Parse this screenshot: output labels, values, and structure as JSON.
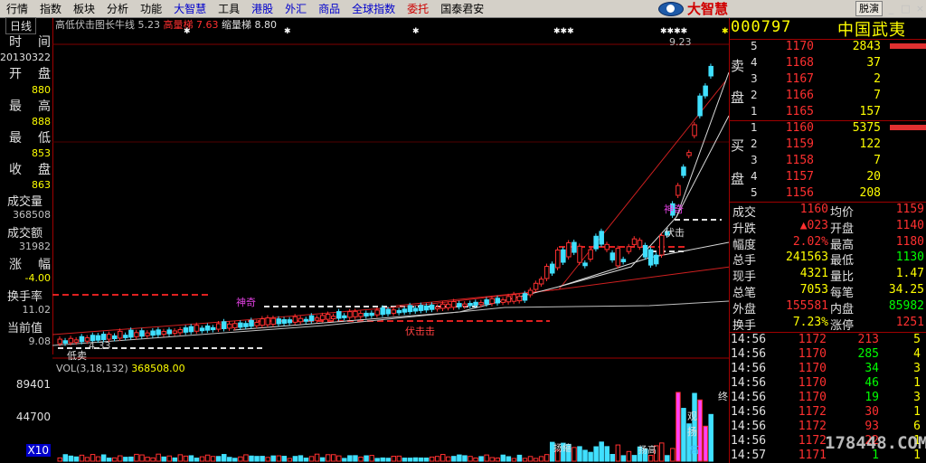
{
  "menu": [
    {
      "label": "行情",
      "color": "normal"
    },
    {
      "label": "指数",
      "color": "normal"
    },
    {
      "label": "板块",
      "color": "normal"
    },
    {
      "label": "分析",
      "color": "normal"
    },
    {
      "label": "功能",
      "color": "normal"
    },
    {
      "label": "大智慧",
      "color": "blue"
    },
    {
      "label": "工具",
      "color": "normal"
    },
    {
      "label": "港股",
      "color": "blue"
    },
    {
      "label": "外汇",
      "color": "blue"
    },
    {
      "label": "商品",
      "color": "blue"
    },
    {
      "label": "全球指数",
      "color": "blue"
    },
    {
      "label": "委托",
      "color": "red"
    },
    {
      "label": "国泰君安",
      "color": "normal"
    }
  ],
  "logo_text": "大智慧",
  "window_buttons": {
    "demo": "脱演",
    "min": "_",
    "restore": "□",
    "close": "×"
  },
  "period": "日线",
  "chart_header": {
    "indicator": "高低伏击图长牛线",
    "v1": "5.23",
    "label2": "高量梯",
    "v2": "7.63",
    "label3": "缩量梯",
    "v3": "8.80"
  },
  "left_panel": {
    "time_label": "时　间",
    "time_value": "20130322",
    "open_label": "开　盘",
    "open_value": "880",
    "high_label": "最　高",
    "high_value": "888",
    "low_label": "最　低",
    "low_value": "853",
    "close_label": "收　盘",
    "close_value": "863",
    "volume_label": "成交量",
    "volume_value": "368508",
    "amount_label": "成交额",
    "amount_value": "31982",
    "change_label": "涨　幅",
    "change_value": "-4.00",
    "turnover_label": "换手率",
    "turnover_value": "11.02",
    "current_label": "当前值",
    "current_value": "9.08"
  },
  "chart_annotations": {
    "shenqi1": "神奇",
    "shenqi2": "神奇",
    "fuji1": "伏击",
    "fuji2": "伏击击",
    "price_low": "4.33",
    "price_high": "9.23",
    "bottom_label": "低卖"
  },
  "volume": {
    "header": "VOL(3,18,132)",
    "header_value": "368508.00",
    "axis": [
      "89401",
      "44700",
      "X10"
    ],
    "tags": [
      "观",
      "扬",
      "高",
      "缩",
      "终",
      "扬缩",
      "扬高"
    ]
  },
  "stock": {
    "code": "000797",
    "name": "中国武夷"
  },
  "order_book": {
    "sell_label": [
      "卖",
      "盘"
    ],
    "buy_label": [
      "买",
      "盘"
    ],
    "asks": [
      {
        "level": "5",
        "price": "1170",
        "qty": "2843"
      },
      {
        "level": "4",
        "price": "1168",
        "qty": "37"
      },
      {
        "level": "3",
        "price": "1167",
        "qty": "2"
      },
      {
        "level": "2",
        "price": "1166",
        "qty": "7"
      },
      {
        "level": "1",
        "price": "1165",
        "qty": "157"
      }
    ],
    "bids": [
      {
        "level": "1",
        "price": "1160",
        "qty": "5375"
      },
      {
        "level": "2",
        "price": "1159",
        "qty": "122"
      },
      {
        "level": "3",
        "price": "1158",
        "qty": "7"
      },
      {
        "level": "4",
        "price": "1157",
        "qty": "20"
      },
      {
        "level": "5",
        "price": "1156",
        "qty": "208"
      }
    ]
  },
  "stats": [
    {
      "l1": "成交",
      "v1": "1160",
      "c1": "#ff3030",
      "l2": "均价",
      "v2": "1159",
      "c2": "#ff3030"
    },
    {
      "l1": "升跌",
      "v1": "▲023",
      "c1": "#ff3030",
      "l2": "开盘",
      "v2": "1140",
      "c2": "#ff3030"
    },
    {
      "l1": "幅度",
      "v1": "2.02%",
      "c1": "#ff3030",
      "l2": "最高",
      "v2": "1180",
      "c2": "#ff3030"
    },
    {
      "l1": "总手",
      "v1": "241563",
      "c1": "#ffff00",
      "l2": "最低",
      "v2": "1130",
      "c2": "#00ff00"
    },
    {
      "l1": "现手",
      "v1": "4321",
      "c1": "#ffff00",
      "l2": "量比",
      "v2": "1.47",
      "c2": "#ffff00"
    },
    {
      "l1": "总笔",
      "v1": "7053",
      "c1": "#ffff00",
      "l2": "每笔",
      "v2": "34.25",
      "c2": "#ffff00"
    },
    {
      "l1": "外盘",
      "v1": "155581",
      "c1": "#ff3030",
      "l2": "内盘",
      "v2": "85982",
      "c2": "#00ff00"
    },
    {
      "l1": "换手",
      "v1": "7.23%",
      "c1": "#ffff00",
      "l2": "涨停",
      "v2": "1251",
      "c2": "#ff3030"
    }
  ],
  "ticks": [
    {
      "time": "14:56",
      "price": "1172",
      "vol": "213",
      "n": "5",
      "color": "#ff3030"
    },
    {
      "time": "14:56",
      "price": "1170",
      "vol": "285",
      "n": "4",
      "color": "#00ff00"
    },
    {
      "time": "14:56",
      "price": "1170",
      "vol": "34",
      "n": "3",
      "color": "#00ff00"
    },
    {
      "time": "14:56",
      "price": "1170",
      "vol": "46",
      "n": "1",
      "color": "#00ff00"
    },
    {
      "time": "14:56",
      "price": "1170",
      "vol": "19",
      "n": "3",
      "color": "#00ff00"
    },
    {
      "time": "14:56",
      "price": "1172",
      "vol": "30",
      "n": "1",
      "color": "#ff3030"
    },
    {
      "time": "14:56",
      "price": "1172",
      "vol": "93",
      "n": "6",
      "color": "#ff3030"
    },
    {
      "time": "14:56",
      "price": "1172",
      "vol": "22",
      "n": "1",
      "color": "#ff3030"
    },
    {
      "time": "14:57",
      "price": "1171",
      "vol": "1",
      "n": "1",
      "color": "#00ff00"
    }
  ],
  "watermark": "178448.COM"
}
